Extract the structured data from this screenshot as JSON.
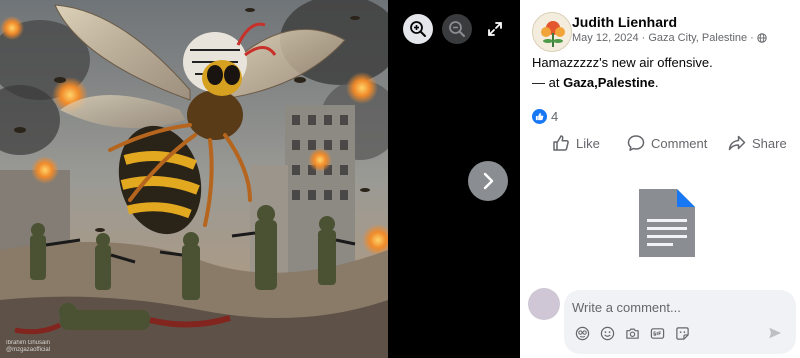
{
  "photo": {
    "watermark_line1": "Ibrahim Ghusain",
    "watermark_line2": "@mzgazaofficial"
  },
  "viewer_icons": {
    "zoom_in": "zoom-in-icon",
    "zoom_out": "zoom-out-icon",
    "fullscreen": "expand-icon",
    "next": "chevron-right-icon"
  },
  "post": {
    "author": "Judith Lienhard",
    "date": "May 12, 2024",
    "location": "Gaza City, Palestine",
    "separator": "·",
    "audience_icon": "globe-icon",
    "text": "Hamazzzzz's new air offensive.",
    "at_prefix": "— at ",
    "at_place": "Gaza,Palestine",
    "at_suffix": "."
  },
  "reactions": {
    "count": "4"
  },
  "actions": {
    "like": "Like",
    "comment": "Comment",
    "share": "Share"
  },
  "comment": {
    "placeholder": "Write a comment...",
    "tools": [
      "avatar-sticker-icon",
      "emoji-icon",
      "camera-icon",
      "gif-icon",
      "sticker-icon"
    ]
  },
  "colors": {
    "accent": "#1877f2",
    "secondary_text": "#65676b",
    "doc_blue": "#1877f2",
    "doc_gray": "#8a8d91"
  }
}
